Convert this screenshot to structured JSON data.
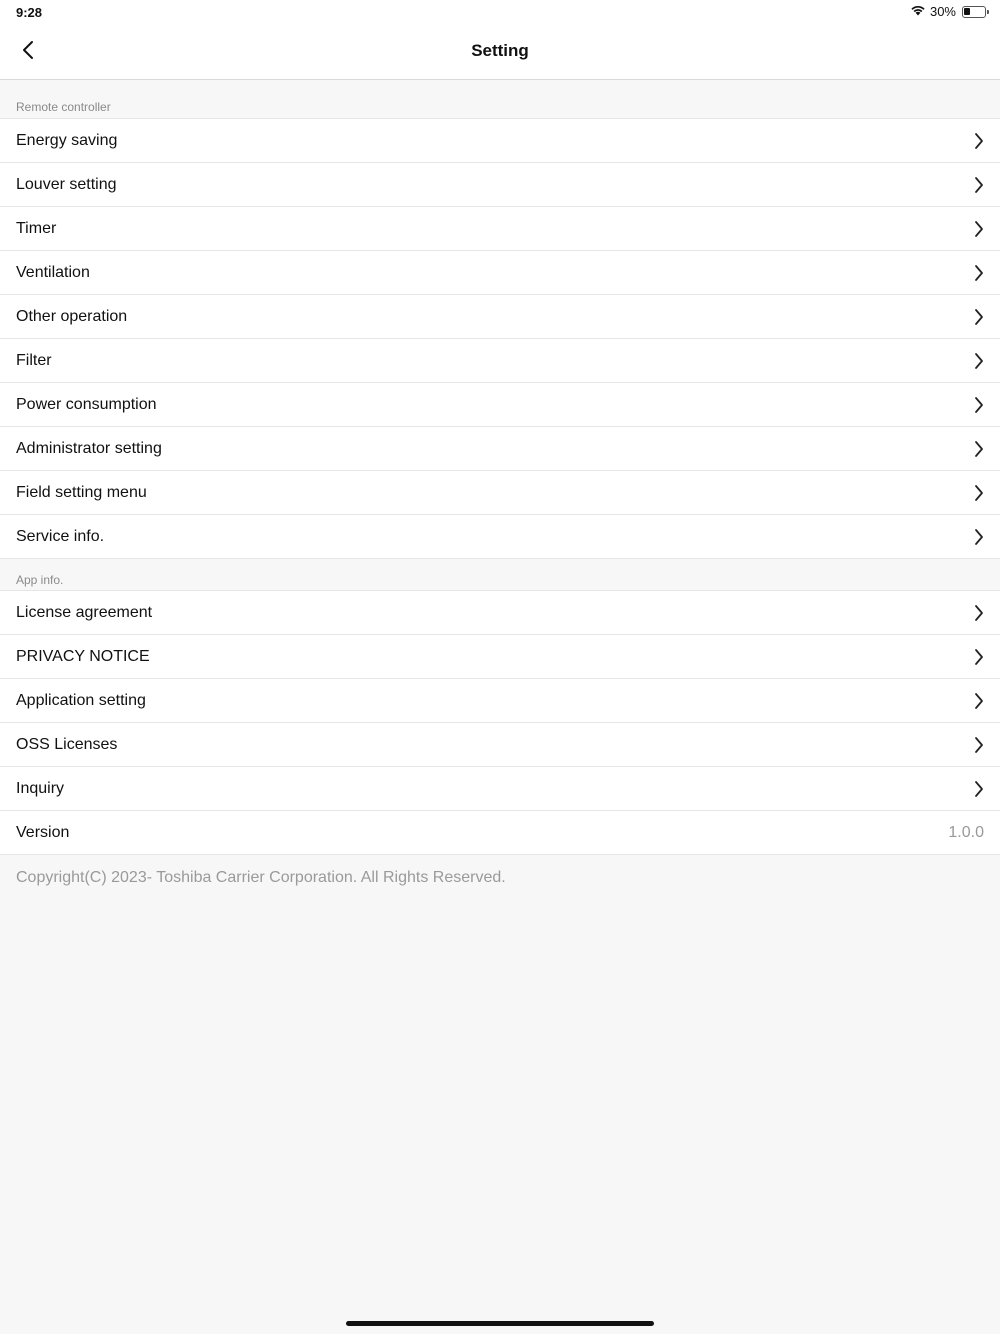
{
  "status_bar": {
    "time": "9:28",
    "battery_text": "30%",
    "battery_level": 0.3
  },
  "header": {
    "title": "Setting"
  },
  "sections": {
    "remote": {
      "title": "Remote controller",
      "items": [
        {
          "label": "Energy saving"
        },
        {
          "label": "Louver setting"
        },
        {
          "label": "Timer"
        },
        {
          "label": "Ventilation"
        },
        {
          "label": "Other operation"
        },
        {
          "label": "Filter"
        },
        {
          "label": "Power consumption"
        },
        {
          "label": "Administrator setting"
        },
        {
          "label": "Field setting menu"
        },
        {
          "label": "Service info."
        }
      ]
    },
    "app": {
      "title": "App info.",
      "items": [
        {
          "label": "License agreement"
        },
        {
          "label": "PRIVACY NOTICE"
        },
        {
          "label": "Application setting"
        },
        {
          "label": "OSS Licenses"
        },
        {
          "label": "Inquiry"
        }
      ],
      "version": {
        "label": "Version",
        "value": "1.0.0"
      }
    }
  },
  "footer": {
    "copyright": "Copyright(C) 2023- Toshiba Carrier Corporation. All Rights Reserved."
  }
}
